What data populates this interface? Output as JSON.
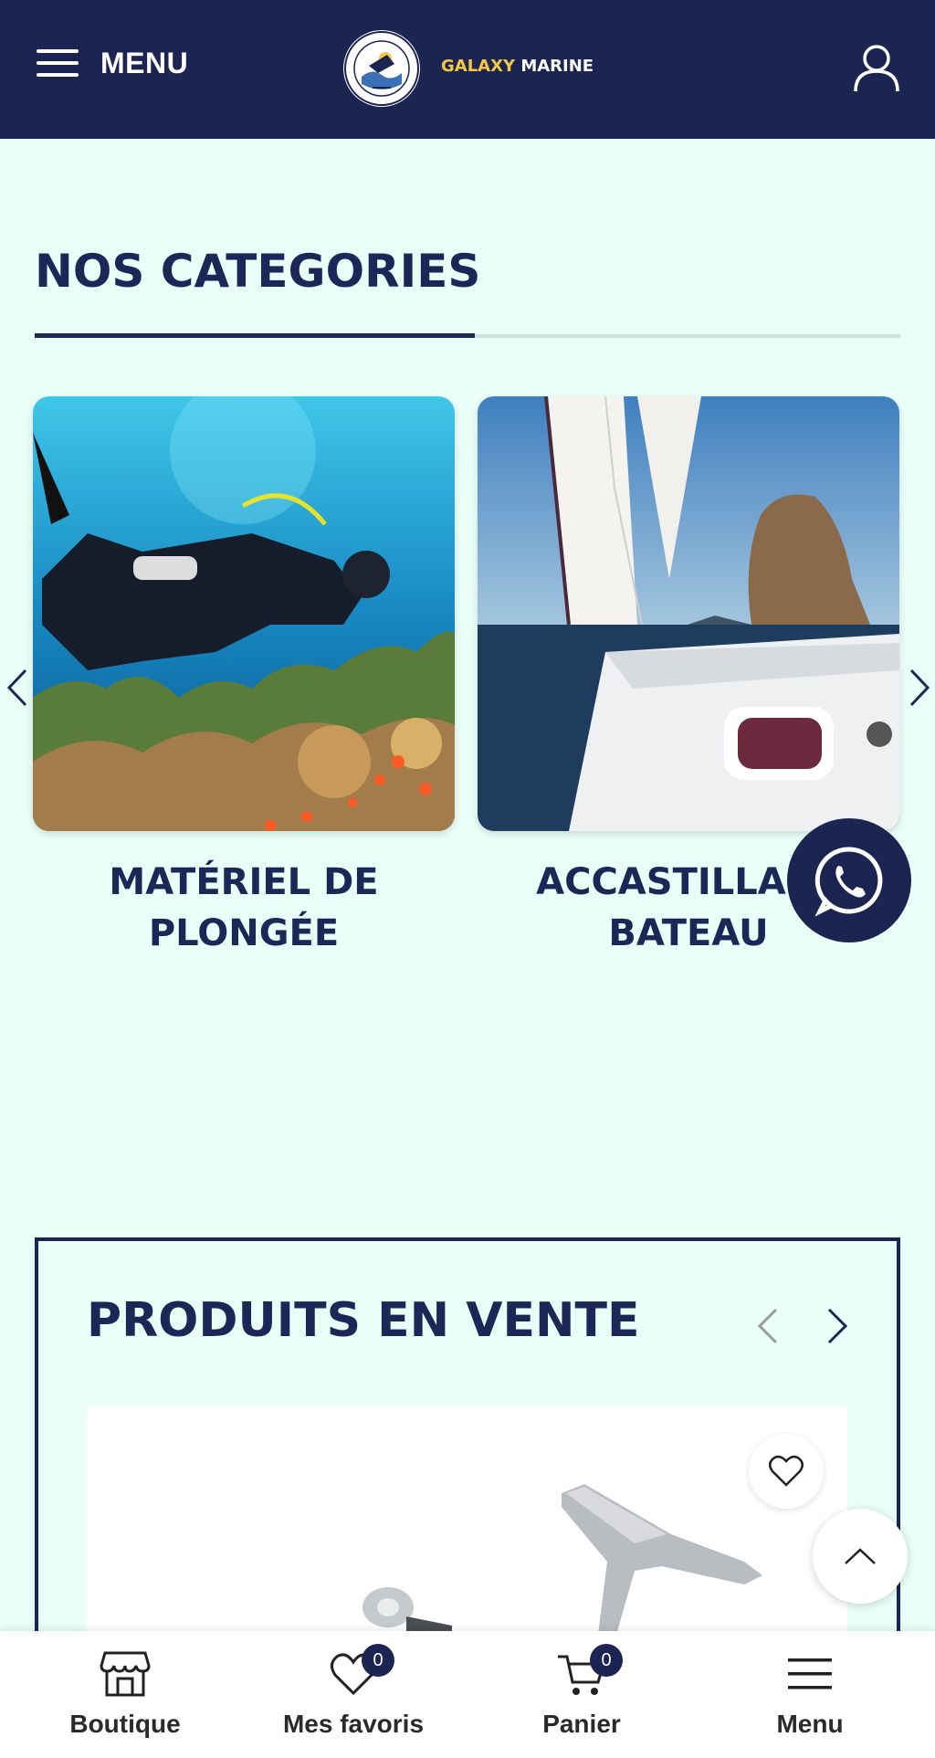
{
  "header": {
    "menu_label": "MENU",
    "brand_part1": "GALAXY",
    "brand_part2": "MARINE",
    "logo_text": "GALAXY MARINE"
  },
  "categories": {
    "title": "NOS CATEGORIES",
    "items": [
      {
        "label": "MATÉRIEL DE\nPLONGÉE",
        "image": "scuba-diver-photo"
      },
      {
        "label": "ACCASTILLAGE\nBATEAU",
        "image": "sailboat-photo"
      }
    ]
  },
  "products": {
    "title": "PRODUITS EN VENTE"
  },
  "bottom_nav": {
    "items": [
      {
        "label": "Boutique",
        "icon": "store-icon"
      },
      {
        "label": "Mes favoris",
        "icon": "heart-icon",
        "badge": "0"
      },
      {
        "label": "Panier",
        "icon": "cart-icon",
        "badge": "0"
      },
      {
        "label": "Menu",
        "icon": "hamburger-icon"
      }
    ]
  },
  "colors": {
    "navy": "#1c2451",
    "background": "#ebfff9",
    "brand_yellow": "#f5c842"
  }
}
